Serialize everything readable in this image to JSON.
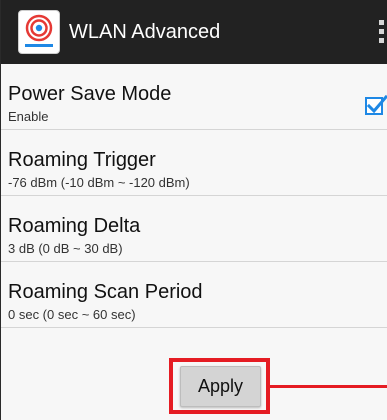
{
  "titlebar": {
    "title": "WLAN Advanced",
    "icon": "wifi-app-icon",
    "menu_icon": "overflow-menu-icon"
  },
  "items": [
    {
      "title": "Power Save Mode",
      "summary": "Enable",
      "checked": true
    },
    {
      "title": "Roaming Trigger",
      "summary": "-76 dBm  (-10 dBm ~ -120 dBm)"
    },
    {
      "title": "Roaming Delta",
      "summary": "3 dB  (0 dB ~ 30 dB)"
    },
    {
      "title": "Roaming Scan Period",
      "summary": "0 sec (0 sec ~ 60 sec)"
    }
  ],
  "apply_label": "Apply",
  "colors": {
    "titlebar": "#222222",
    "accent_checkbox": "#1e88e5",
    "highlight": "#e51c23"
  }
}
